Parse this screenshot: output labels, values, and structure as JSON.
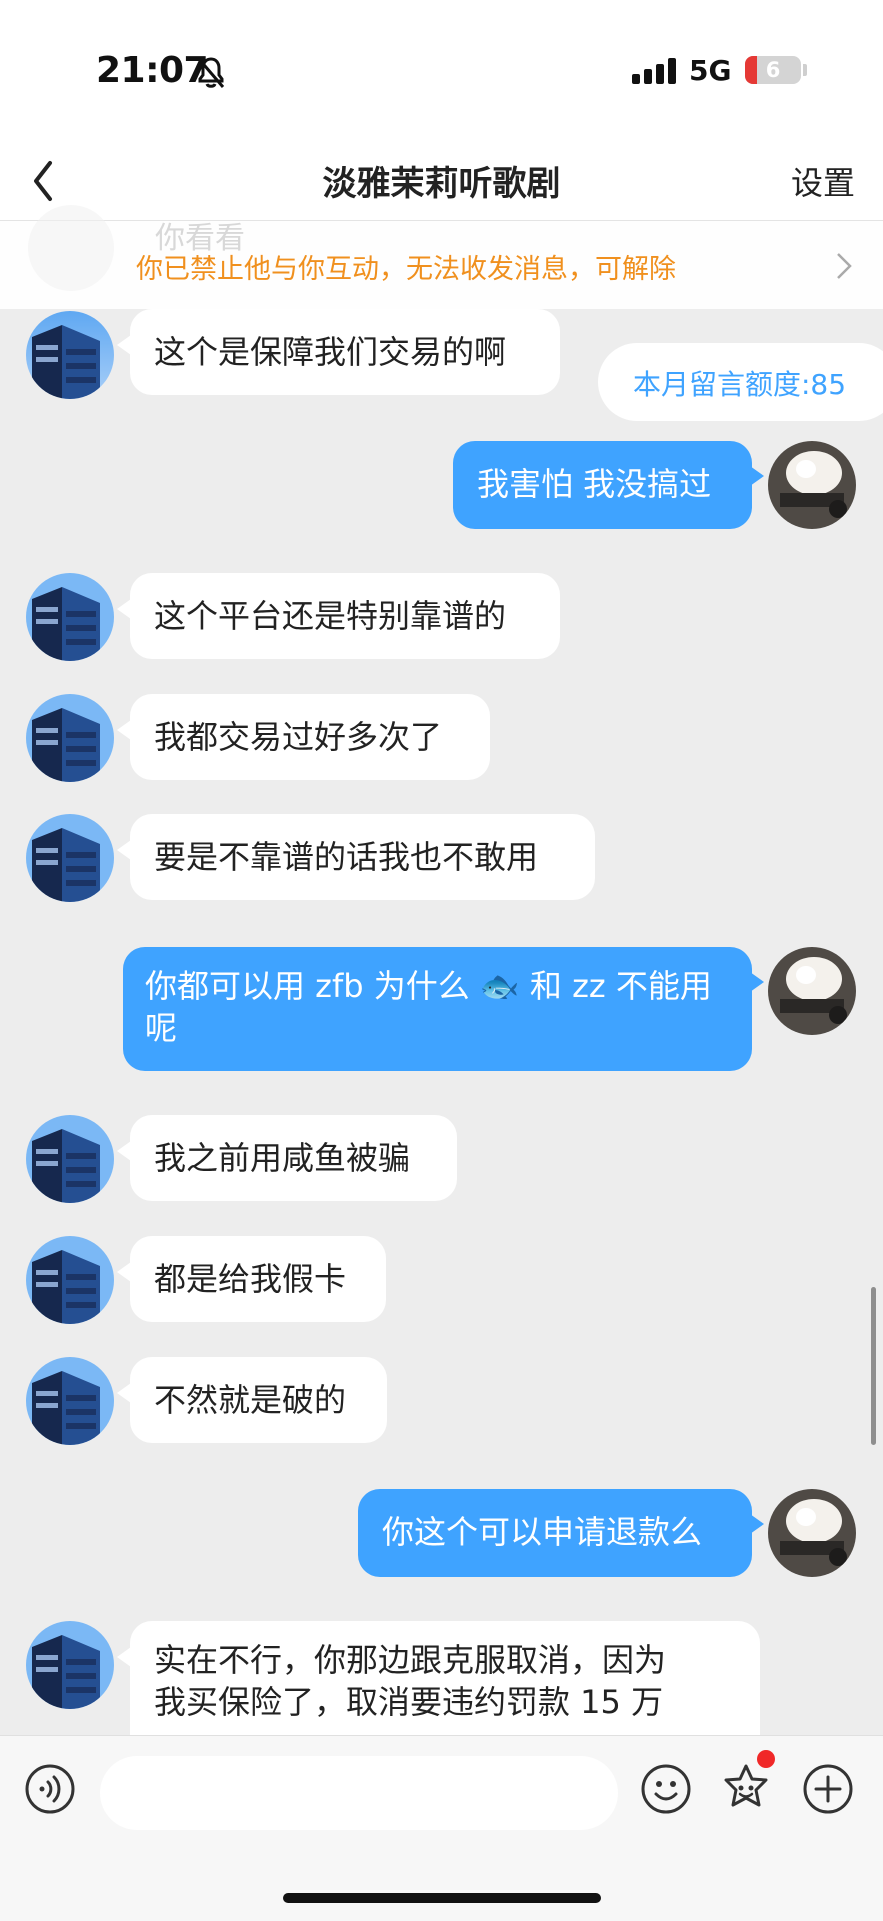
{
  "status_bar": {
    "time": "21:07",
    "network": "5G",
    "battery": "6"
  },
  "nav": {
    "title": "淡雅茉莉听歌剧",
    "settings_label": "设置"
  },
  "notice": {
    "ghost_text": "你看看",
    "text": "你已禁止他与你互动，无法收发消息，可解除"
  },
  "quota_label": "本月留言额度:85",
  "messages": [
    {
      "from": "other",
      "text": "这个是保障我们交易的啊"
    },
    {
      "from": "me",
      "text": "我害怕 我没搞过"
    },
    {
      "from": "other",
      "text": "这个平台还是特别靠谱的"
    },
    {
      "from": "other",
      "text": "我都交易过好多次了"
    },
    {
      "from": "other",
      "text": "要是不靠谱的话我也不敢用"
    },
    {
      "from": "me",
      "line1": "你都可以用 zfb 为什么 ",
      "emoji": "🐟",
      "line1_end": " 和 zz 不能用",
      "line2": "呢"
    },
    {
      "from": "other",
      "text": "我之前用咸鱼被骗"
    },
    {
      "from": "other",
      "text": "都是给我假卡"
    },
    {
      "from": "other",
      "text": "不然就是破的"
    },
    {
      "from": "me",
      "text": "你这个可以申请退款么"
    },
    {
      "from": "other",
      "line1": "实在不行，你那边跟克服取消，因为",
      "line2": "我买保险了，取消要违约罚款 15 万"
    }
  ],
  "input": {
    "placeholder": ""
  },
  "icons": {
    "back": "chevron-left-icon",
    "notice_arrow": "chevron-right-icon",
    "voice": "voice-icon",
    "emoji": "smiley-icon",
    "sticker": "sticker-icon",
    "plus": "plus-circle-icon",
    "bell": "bell-slash-icon",
    "signal": "signal-icon"
  },
  "colors": {
    "bubble_out": "#3fa3ff",
    "notice_text": "#f0901e",
    "quota_text": "#3fa3ff",
    "background": "#ededed"
  }
}
